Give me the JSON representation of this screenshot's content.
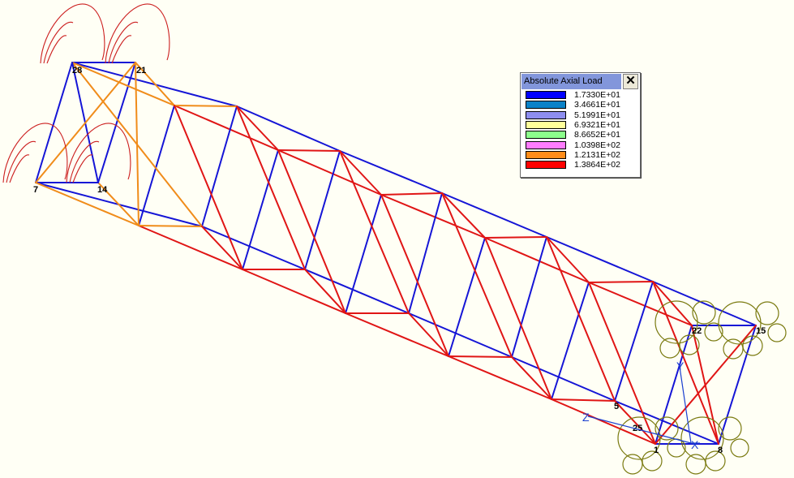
{
  "legend": {
    "title": "Absolute Axial Load",
    "close_glyph": "✕",
    "entries": [
      {
        "value": "1.7330E+01",
        "color": "#0000ff"
      },
      {
        "value": "3.4661E+01",
        "color": "#0b82c8"
      },
      {
        "value": "5.1991E+01",
        "color": "#8e8ef0"
      },
      {
        "value": "6.9321E+01",
        "color": "#ffff9a"
      },
      {
        "value": "8.6652E+01",
        "color": "#8cff8c"
      },
      {
        "value": "1.0398E+02",
        "color": "#ff7cff"
      },
      {
        "value": "1.2131E+02",
        "color": "#ff8c1a"
      },
      {
        "value": "1.3864E+02",
        "color": "#ff0000"
      }
    ]
  },
  "colors": {
    "background": "#fffff5",
    "member_low": "#1515d6",
    "member_mid": "#f08c1a",
    "member_high": "#e01515",
    "support": "#7a7a10",
    "load_arrow": "#cc2020",
    "axis": "#1a3fd0"
  },
  "node_labels": {
    "n28": "28",
    "n21": "21",
    "n7": "7",
    "n14": "14",
    "n22": "22",
    "n15": "15",
    "n5": "5",
    "n25": "25",
    "n1": "1",
    "n8": "8"
  },
  "axes": {
    "z": "Z",
    "x": "X",
    "y": "Y"
  },
  "icons": {
    "load_arrows": "curved-load-arrow-icon",
    "supports": "roller-support-icon"
  }
}
